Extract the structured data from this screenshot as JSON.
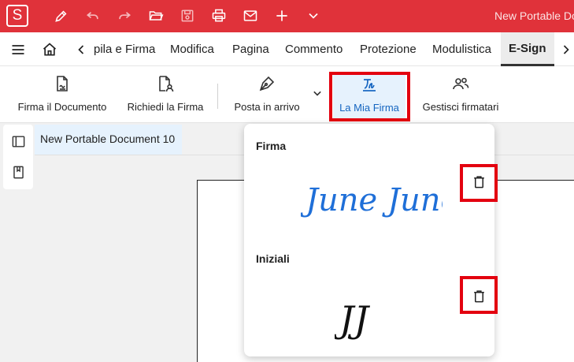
{
  "app": {
    "logo_letter": "S",
    "document_title": "New Portable Do",
    "icons": [
      "pen-icon",
      "undo-icon",
      "redo-icon",
      "folder-open-icon",
      "save-icon",
      "print-icon",
      "mail-icon",
      "plus-icon",
      "chevron-down-icon"
    ]
  },
  "menu": {
    "tabs": [
      {
        "label": "pila e Firma"
      },
      {
        "label": "Modifica"
      },
      {
        "label": "Pagina"
      },
      {
        "label": "Commento"
      },
      {
        "label": "Protezione"
      },
      {
        "label": "Modulistica"
      },
      {
        "label": "E-Sign",
        "active": true
      }
    ]
  },
  "ribbon": {
    "buttons": [
      {
        "label": "Firma il Documento",
        "icon": "sign-document-icon"
      },
      {
        "label": "Richiedi la Firma",
        "icon": "request-signature-icon"
      },
      {
        "label": "Posta in arrivo",
        "icon": "pen-nib-icon"
      },
      {
        "label": "La Mia Firma",
        "icon": "my-signature-icon",
        "selected": true
      },
      {
        "label": "Gestisci firmatari",
        "icon": "users-icon"
      }
    ]
  },
  "document_tab": {
    "label": "New Portable Document 10"
  },
  "signature_popup": {
    "signature_heading": "Firma",
    "signature_text": "June June",
    "initials_heading": "Iniziali",
    "initials_text": "JJ"
  },
  "colors": {
    "titlebar": "#e0323a",
    "accent_blue": "#1565c0",
    "signature_blue": "#1f6fd8",
    "highlight_red": "#e3000f"
  }
}
